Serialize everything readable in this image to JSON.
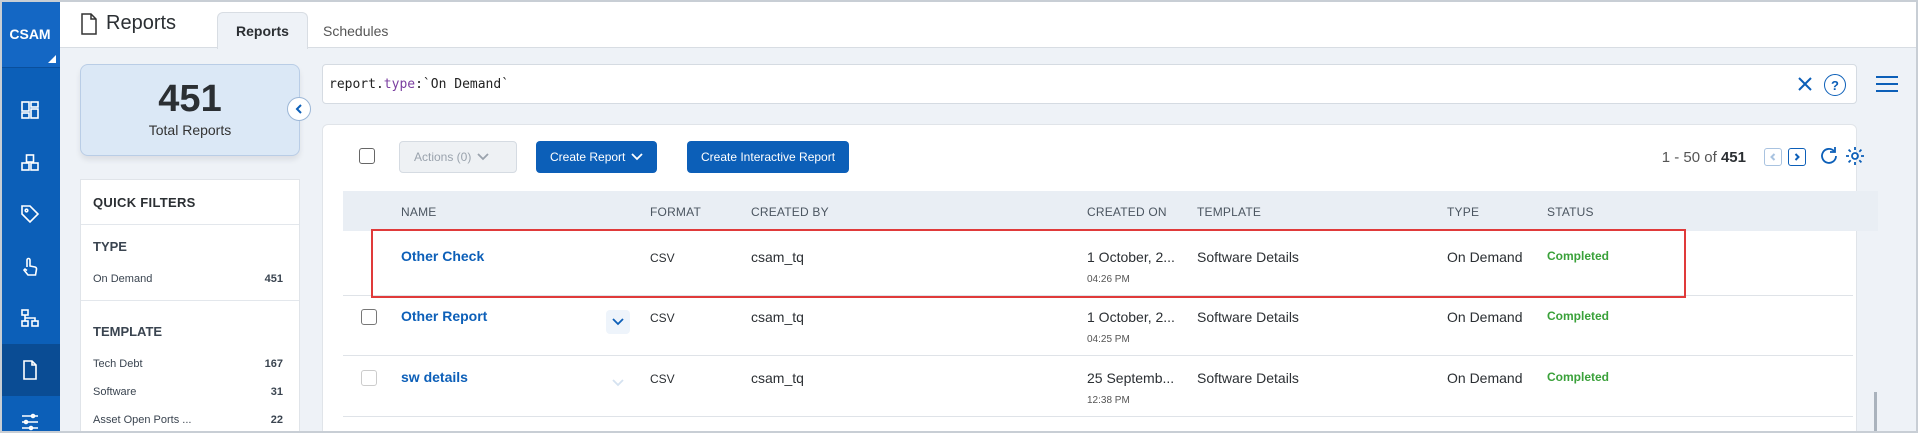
{
  "app": {
    "logo": "CSAM"
  },
  "header": {
    "title": "Reports",
    "tabs": [
      {
        "label": "Reports",
        "active": true
      },
      {
        "label": "Schedules",
        "active": false
      }
    ]
  },
  "summary": {
    "count": "451",
    "label": "Total Reports"
  },
  "quick_filters": {
    "title": "QUICK FILTERS",
    "sections": [
      {
        "title": "TYPE",
        "items": [
          {
            "label": "On Demand",
            "count": "451"
          }
        ]
      },
      {
        "title": "TEMPLATE",
        "items": [
          {
            "label": "Tech Debt",
            "count": "167"
          },
          {
            "label": "Software",
            "count": "31"
          },
          {
            "label": "Asset Open Ports ...",
            "count": "22"
          }
        ]
      }
    ]
  },
  "search": {
    "prefix": "report.",
    "field": "type",
    "value": ":`On Demand`"
  },
  "toolbar": {
    "actions_label": "Actions (0)",
    "create_report_label": "Create Report",
    "create_interactive_label": "Create Interactive Report",
    "pager_range": "1 - 50 of",
    "pager_total": "451"
  },
  "table": {
    "columns": [
      "NAME",
      "FORMAT",
      "CREATED BY",
      "CREATED ON",
      "TEMPLATE",
      "TYPE",
      "STATUS"
    ],
    "rows": [
      {
        "name": "Other Check",
        "format": "CSV",
        "created_by": "csam_tq",
        "created_on": "1 October, 2...",
        "time": "04:26 PM",
        "template": "Software Details",
        "type": "On Demand",
        "status": "Completed"
      },
      {
        "name": "Other Report",
        "format": "CSV",
        "created_by": "csam_tq",
        "created_on": "1 October, 2...",
        "time": "04:25 PM",
        "template": "Software Details",
        "type": "On Demand",
        "status": "Completed"
      },
      {
        "name": "sw details",
        "format": "CSV",
        "created_by": "csam_tq",
        "created_on": "25 Septemb...",
        "time": "12:38 PM",
        "template": "Software Details",
        "type": "On Demand",
        "status": "Completed"
      }
    ]
  },
  "colors": {
    "primary": "#0c5fb8",
    "rail": "#0c5fb8",
    "status_completed": "#3aa13a",
    "highlight": "#e03a3a"
  },
  "icons": [
    "dashboard-icon",
    "assets-icon",
    "tag-icon",
    "touch-icon",
    "network-icon",
    "reports-icon",
    "settings-sliders-icon"
  ]
}
